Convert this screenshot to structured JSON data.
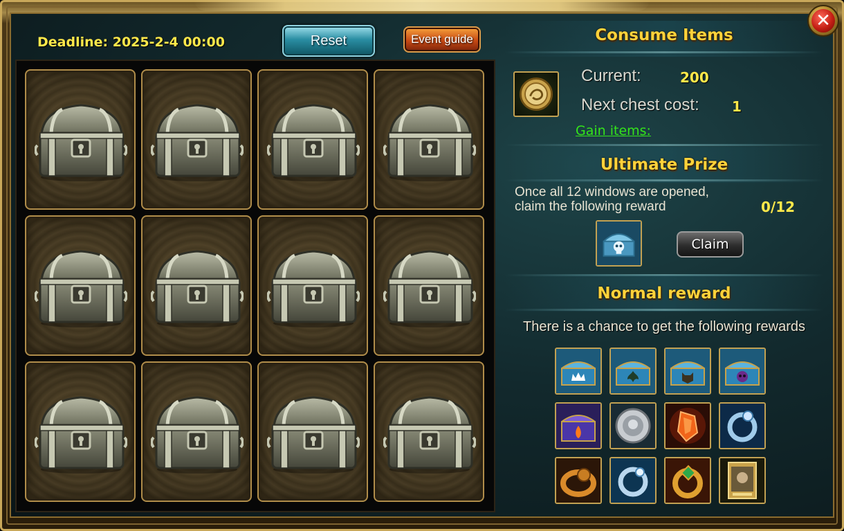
{
  "header": {
    "deadline": "Deadline: 2025-2-4 00:00",
    "reset_label": "Reset",
    "guide_label": "Event guide"
  },
  "chest_grid": {
    "count": 12
  },
  "consume": {
    "title": "Consume Items",
    "current_label": "Current:",
    "current_value": "200",
    "next_label": "Next chest cost:",
    "next_value": "1",
    "gain_label": "Gain items:"
  },
  "ultimate": {
    "title": "Ultimate Prize",
    "line1": "Once all 12 windows are opened,",
    "line2": "claim the following reward",
    "progress": "0/12",
    "claim_label": "Claim"
  },
  "normal": {
    "title": "Normal reward",
    "chance_text": "There is a chance to get the following rewards",
    "items": [
      "crown-chest-icon",
      "fleur-chest-icon",
      "wolf-chest-icon",
      "skull-chest-icon",
      "purple-chest-icon",
      "silver-coin-icon",
      "orange-gem-icon",
      "blue-ring-icon",
      "gold-ring-icon",
      "frost-ring-icon",
      "ruby-ring-icon",
      "card-pack-icon"
    ]
  },
  "colors": {
    "accent_gold": "#ffd23a",
    "value_yellow": "#ffe84a",
    "link_green": "#34e41a"
  }
}
